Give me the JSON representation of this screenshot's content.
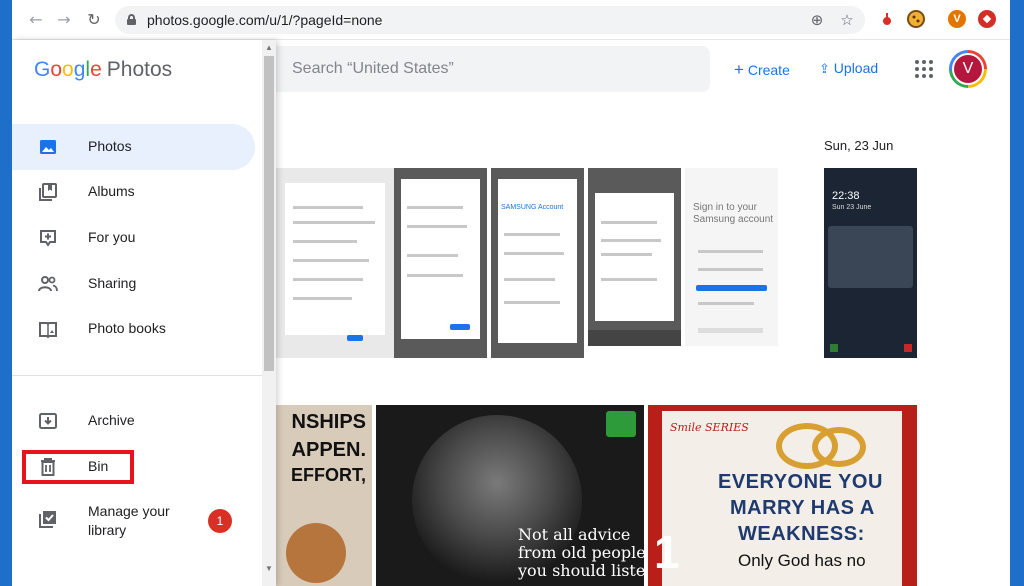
{
  "browser": {
    "url": "photos.google.com/u/1/?pageId=none",
    "extensions": [
      {
        "name": "red-extension-icon",
        "color": "#d93025"
      },
      {
        "name": "cookie-extension-icon",
        "color": "#7a4b12"
      },
      {
        "name": "profile-v-icon",
        "color": "#e37400",
        "label": "V"
      },
      {
        "name": "lastpass-extension-icon",
        "color": "#d32d27"
      }
    ]
  },
  "brand": {
    "google": [
      "G",
      "o",
      "o",
      "g",
      "l",
      "e"
    ],
    "google_colors": [
      "#4285f4",
      "#ea4335",
      "#fbbc04",
      "#4285f4",
      "#34a853",
      "#ea4335"
    ],
    "product": "Photos"
  },
  "sidebar": {
    "items": [
      {
        "label": "Photos",
        "icon": "photos-icon",
        "active": true
      },
      {
        "label": "Albums",
        "icon": "albums-icon"
      },
      {
        "label": "For you",
        "icon": "for-you-icon"
      },
      {
        "label": "Sharing",
        "icon": "sharing-icon"
      },
      {
        "label": "Photo books",
        "icon": "photo-books-icon"
      }
    ],
    "lower_items": [
      {
        "label": "Archive",
        "icon": "archive-icon"
      },
      {
        "label": "Bin",
        "icon": "bin-icon",
        "highlighted": true
      },
      {
        "label_line1": "Manage your",
        "label_line2": "library",
        "icon": "manage-library-icon",
        "badge": "1"
      }
    ]
  },
  "header": {
    "search_placeholder": "Search “United States”",
    "create_label": "Create",
    "upload_label": "Upload",
    "avatar_letter": "V"
  },
  "content": {
    "date_label": "Sun, 23 Jun",
    "phone_texts": {
      "samsung_account": "SAMSUNG Account",
      "sign_in": "Sign in to your",
      "samsung_acc": "Samsung account",
      "lock_time": "22:38",
      "lock_date": "Sun 23 June"
    },
    "poster1_lines": [
      "NSHIPS",
      "APPEN.",
      "EFFORT,"
    ],
    "poster2_lines": [
      "Not all advice",
      "from old people",
      "you should listen"
    ],
    "poster3": {
      "logo": "Smile SERIES",
      "headline": [
        "EVERYONE YOU",
        "MARRY HAS A",
        "WEAKNESS:"
      ],
      "sub": "Only God has no",
      "number": "1"
    }
  },
  "colors": {
    "accent": "#1a73e8",
    "active_bg": "#e8f0fe",
    "highlight_border": "#e8141b",
    "badge": "#d93025",
    "desktop": "#1e6fc9"
  }
}
